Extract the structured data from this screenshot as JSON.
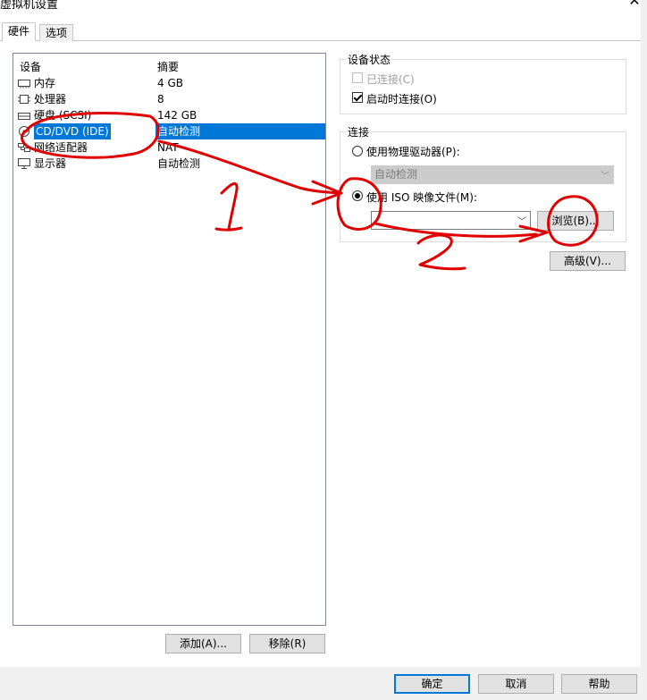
{
  "window": {
    "title": "虚拟机设置",
    "close_glyph": "✕"
  },
  "tabs": [
    {
      "label": "硬件",
      "active": true
    },
    {
      "label": "选项",
      "active": false
    }
  ],
  "device_list": {
    "columns": [
      "设备",
      "摘要"
    ],
    "rows": [
      {
        "device": "内存",
        "summary": "4 GB",
        "icon": "memory-icon"
      },
      {
        "device": "处理器",
        "summary": "8",
        "icon": "processor-icon"
      },
      {
        "device": "硬盘 (SCSI)",
        "summary": "142 GB",
        "icon": "hard-disk-icon"
      },
      {
        "device": "CD/DVD (IDE)",
        "summary": "自动检测",
        "icon": "cd-dvd-icon",
        "selected": true
      },
      {
        "device": "网络适配器",
        "summary": "NAT",
        "icon": "network-adapter-icon"
      },
      {
        "device": "显示器",
        "summary": "自动检测",
        "icon": "display-icon"
      }
    ]
  },
  "device_status": {
    "title": "设备状态",
    "connected_label": "已连接(C)",
    "connect_at_power_on_label": "启动时连接(O)"
  },
  "connection": {
    "title": "连接",
    "physical_drive_label": "使用物理驱动器(P):",
    "physical_drive_value": "自动检测",
    "iso_label": "使用 ISO 映像文件(M):",
    "iso_value": "",
    "browse_label": "浏览(B)...",
    "advanced_label": "高级(V)..."
  },
  "list_buttons": {
    "add_label": "添加(A)...",
    "remove_label": "移除(R)"
  },
  "footer": {
    "ok_label": "确定",
    "cancel_label": "取消",
    "help_label": "帮助"
  },
  "annotations": {
    "step1": "1",
    "step2": "2",
    "color": "#e00000"
  },
  "colors": {
    "selection": "#0078d7",
    "default_button_border": "#0078d7"
  }
}
